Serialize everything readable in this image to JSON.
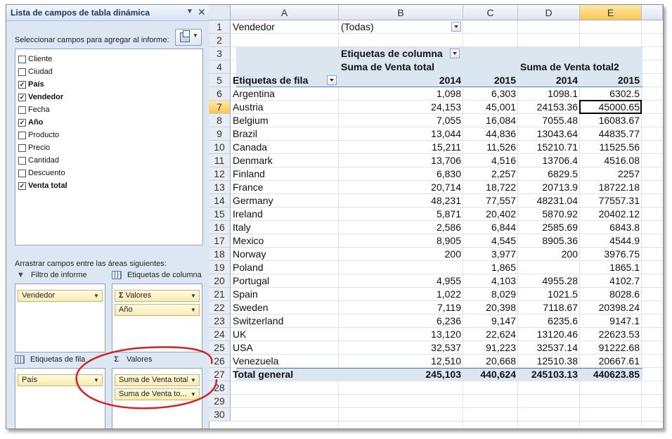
{
  "pane": {
    "title": "Lista de campos de tabla dinámica",
    "choose_label": "Seleccionar campos para agregar al informe:",
    "drag_label": "Arrastrar campos entre las áreas siguientes:",
    "fields": [
      {
        "label": "Cliente",
        "checked": false
      },
      {
        "label": "Ciudad",
        "checked": false
      },
      {
        "label": "País",
        "checked": true
      },
      {
        "label": "Vendedor",
        "checked": true
      },
      {
        "label": "Fecha",
        "checked": false
      },
      {
        "label": "Año",
        "checked": true
      },
      {
        "label": "Producto",
        "checked": false
      },
      {
        "label": "Precio",
        "checked": false
      },
      {
        "label": "Cantidad",
        "checked": false
      },
      {
        "label": "Descuento",
        "checked": false
      },
      {
        "label": "Venta total",
        "checked": true
      }
    ],
    "areas": {
      "filter_label": "Filtro de informe",
      "columns_label": "Etiquetas de columna",
      "rows_label": "Etiquetas de fila",
      "values_label": "Valores",
      "filter_items": [
        "Vendedor"
      ],
      "column_items": [
        "Valores",
        "Año"
      ],
      "row_items": [
        "País"
      ],
      "value_items": [
        "Suma de Venta total",
        "Suma de Venta to..."
      ]
    }
  },
  "sheet": {
    "columns": [
      "A",
      "B",
      "C",
      "D",
      "E"
    ],
    "active_column": "E",
    "active_row": "7",
    "filter_field": "Vendedor",
    "filter_value": "(Todas)",
    "col_labels_header": "Etiquetas de columna",
    "row_labels_header": "Etiquetas de fila",
    "measure1": "Suma de Venta total",
    "measure2": "Suma de Venta total2",
    "years": [
      "2014",
      "2015",
      "2014",
      "2015"
    ],
    "data_rows": [
      {
        "row": "6",
        "country": "Argentina",
        "v1": "1,098",
        "v2": "6,303",
        "v3": "1098.1",
        "v4": "6302.5"
      },
      {
        "row": "7",
        "country": "Austria",
        "v1": "24,153",
        "v2": "45,001",
        "v3": "24153.36",
        "v4": "45000.65"
      },
      {
        "row": "8",
        "country": "Belgium",
        "v1": "7,055",
        "v2": "16,084",
        "v3": "7055.48",
        "v4": "16083.67"
      },
      {
        "row": "9",
        "country": "Brazil",
        "v1": "13,044",
        "v2": "44,836",
        "v3": "13043.64",
        "v4": "44835.77"
      },
      {
        "row": "10",
        "country": "Canada",
        "v1": "15,211",
        "v2": "11,526",
        "v3": "15210.71",
        "v4": "11525.56"
      },
      {
        "row": "11",
        "country": "Denmark",
        "v1": "13,706",
        "v2": "4,516",
        "v3": "13706.4",
        "v4": "4516.08"
      },
      {
        "row": "12",
        "country": "Finland",
        "v1": "6,830",
        "v2": "2,257",
        "v3": "6829.5",
        "v4": "2257"
      },
      {
        "row": "13",
        "country": "France",
        "v1": "20,714",
        "v2": "18,722",
        "v3": "20713.9",
        "v4": "18722.18"
      },
      {
        "row": "14",
        "country": "Germany",
        "v1": "48,231",
        "v2": "77,557",
        "v3": "48231.04",
        "v4": "77557.31"
      },
      {
        "row": "15",
        "country": "Ireland",
        "v1": "5,871",
        "v2": "20,402",
        "v3": "5870.92",
        "v4": "20402.12"
      },
      {
        "row": "16",
        "country": "Italy",
        "v1": "2,586",
        "v2": "6,844",
        "v3": "2585.69",
        "v4": "6843.8"
      },
      {
        "row": "17",
        "country": "Mexico",
        "v1": "8,905",
        "v2": "4,545",
        "v3": "8905.36",
        "v4": "4544.9"
      },
      {
        "row": "18",
        "country": "Norway",
        "v1": "200",
        "v2": "3,977",
        "v3": "200",
        "v4": "3976.75"
      },
      {
        "row": "19",
        "country": "Poland",
        "v1": "",
        "v2": "1,865",
        "v3": "",
        "v4": "1865.1"
      },
      {
        "row": "20",
        "country": "Portugal",
        "v1": "4,955",
        "v2": "4,103",
        "v3": "4955.28",
        "v4": "4102.7"
      },
      {
        "row": "21",
        "country": "Spain",
        "v1": "1,022",
        "v2": "8,029",
        "v3": "1021.5",
        "v4": "8028.6"
      },
      {
        "row": "22",
        "country": "Sweden",
        "v1": "7,119",
        "v2": "20,398",
        "v3": "7118.67",
        "v4": "20398.24"
      },
      {
        "row": "23",
        "country": "Switzerland",
        "v1": "6,236",
        "v2": "9,147",
        "v3": "6235.6",
        "v4": "9147.1"
      },
      {
        "row": "24",
        "country": "UK",
        "v1": "13,120",
        "v2": "22,624",
        "v3": "13120.46",
        "v4": "22623.53"
      },
      {
        "row": "25",
        "country": "USA",
        "v1": "32,537",
        "v2": "91,223",
        "v3": "32537.14",
        "v4": "91222.68"
      },
      {
        "row": "26",
        "country": "Venezuela",
        "v1": "12,510",
        "v2": "20,668",
        "v3": "12510.38",
        "v4": "20667.61"
      }
    ],
    "total": {
      "row": "27",
      "label": "Total general",
      "v1": "245,103",
      "v2": "440,624",
      "v3": "245103.13",
      "v4": "440623.85"
    },
    "empty_rows": [
      "28",
      "29",
      "30"
    ],
    "annotation_color": "#d92020",
    "accent_color": "#dce6f1"
  }
}
